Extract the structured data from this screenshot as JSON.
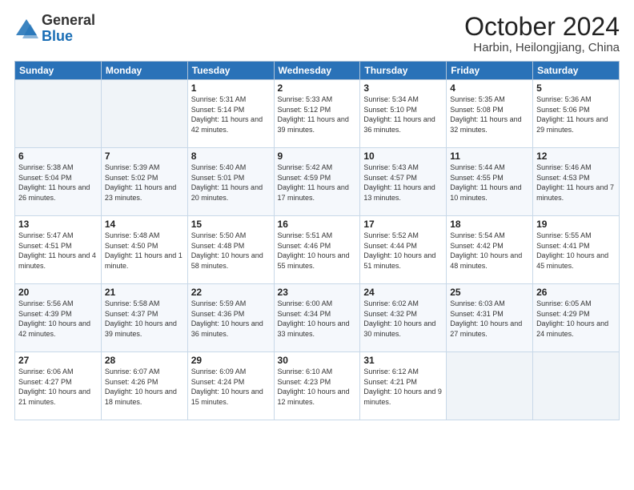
{
  "logo": {
    "general": "General",
    "blue": "Blue"
  },
  "title": "October 2024",
  "location": "Harbin, Heilongjiang, China",
  "days_of_week": [
    "Sunday",
    "Monday",
    "Tuesday",
    "Wednesday",
    "Thursday",
    "Friday",
    "Saturday"
  ],
  "weeks": [
    [
      {
        "day": "",
        "sunrise": "",
        "sunset": "",
        "daylight": ""
      },
      {
        "day": "",
        "sunrise": "",
        "sunset": "",
        "daylight": ""
      },
      {
        "day": "1",
        "sunrise": "Sunrise: 5:31 AM",
        "sunset": "Sunset: 5:14 PM",
        "daylight": "Daylight: 11 hours and 42 minutes."
      },
      {
        "day": "2",
        "sunrise": "Sunrise: 5:33 AM",
        "sunset": "Sunset: 5:12 PM",
        "daylight": "Daylight: 11 hours and 39 minutes."
      },
      {
        "day": "3",
        "sunrise": "Sunrise: 5:34 AM",
        "sunset": "Sunset: 5:10 PM",
        "daylight": "Daylight: 11 hours and 36 minutes."
      },
      {
        "day": "4",
        "sunrise": "Sunrise: 5:35 AM",
        "sunset": "Sunset: 5:08 PM",
        "daylight": "Daylight: 11 hours and 32 minutes."
      },
      {
        "day": "5",
        "sunrise": "Sunrise: 5:36 AM",
        "sunset": "Sunset: 5:06 PM",
        "daylight": "Daylight: 11 hours and 29 minutes."
      }
    ],
    [
      {
        "day": "6",
        "sunrise": "Sunrise: 5:38 AM",
        "sunset": "Sunset: 5:04 PM",
        "daylight": "Daylight: 11 hours and 26 minutes."
      },
      {
        "day": "7",
        "sunrise": "Sunrise: 5:39 AM",
        "sunset": "Sunset: 5:02 PM",
        "daylight": "Daylight: 11 hours and 23 minutes."
      },
      {
        "day": "8",
        "sunrise": "Sunrise: 5:40 AM",
        "sunset": "Sunset: 5:01 PM",
        "daylight": "Daylight: 11 hours and 20 minutes."
      },
      {
        "day": "9",
        "sunrise": "Sunrise: 5:42 AM",
        "sunset": "Sunset: 4:59 PM",
        "daylight": "Daylight: 11 hours and 17 minutes."
      },
      {
        "day": "10",
        "sunrise": "Sunrise: 5:43 AM",
        "sunset": "Sunset: 4:57 PM",
        "daylight": "Daylight: 11 hours and 13 minutes."
      },
      {
        "day": "11",
        "sunrise": "Sunrise: 5:44 AM",
        "sunset": "Sunset: 4:55 PM",
        "daylight": "Daylight: 11 hours and 10 minutes."
      },
      {
        "day": "12",
        "sunrise": "Sunrise: 5:46 AM",
        "sunset": "Sunset: 4:53 PM",
        "daylight": "Daylight: 11 hours and 7 minutes."
      }
    ],
    [
      {
        "day": "13",
        "sunrise": "Sunrise: 5:47 AM",
        "sunset": "Sunset: 4:51 PM",
        "daylight": "Daylight: 11 hours and 4 minutes."
      },
      {
        "day": "14",
        "sunrise": "Sunrise: 5:48 AM",
        "sunset": "Sunset: 4:50 PM",
        "daylight": "Daylight: 11 hours and 1 minute."
      },
      {
        "day": "15",
        "sunrise": "Sunrise: 5:50 AM",
        "sunset": "Sunset: 4:48 PM",
        "daylight": "Daylight: 10 hours and 58 minutes."
      },
      {
        "day": "16",
        "sunrise": "Sunrise: 5:51 AM",
        "sunset": "Sunset: 4:46 PM",
        "daylight": "Daylight: 10 hours and 55 minutes."
      },
      {
        "day": "17",
        "sunrise": "Sunrise: 5:52 AM",
        "sunset": "Sunset: 4:44 PM",
        "daylight": "Daylight: 10 hours and 51 minutes."
      },
      {
        "day": "18",
        "sunrise": "Sunrise: 5:54 AM",
        "sunset": "Sunset: 4:42 PM",
        "daylight": "Daylight: 10 hours and 48 minutes."
      },
      {
        "day": "19",
        "sunrise": "Sunrise: 5:55 AM",
        "sunset": "Sunset: 4:41 PM",
        "daylight": "Daylight: 10 hours and 45 minutes."
      }
    ],
    [
      {
        "day": "20",
        "sunrise": "Sunrise: 5:56 AM",
        "sunset": "Sunset: 4:39 PM",
        "daylight": "Daylight: 10 hours and 42 minutes."
      },
      {
        "day": "21",
        "sunrise": "Sunrise: 5:58 AM",
        "sunset": "Sunset: 4:37 PM",
        "daylight": "Daylight: 10 hours and 39 minutes."
      },
      {
        "day": "22",
        "sunrise": "Sunrise: 5:59 AM",
        "sunset": "Sunset: 4:36 PM",
        "daylight": "Daylight: 10 hours and 36 minutes."
      },
      {
        "day": "23",
        "sunrise": "Sunrise: 6:00 AM",
        "sunset": "Sunset: 4:34 PM",
        "daylight": "Daylight: 10 hours and 33 minutes."
      },
      {
        "day": "24",
        "sunrise": "Sunrise: 6:02 AM",
        "sunset": "Sunset: 4:32 PM",
        "daylight": "Daylight: 10 hours and 30 minutes."
      },
      {
        "day": "25",
        "sunrise": "Sunrise: 6:03 AM",
        "sunset": "Sunset: 4:31 PM",
        "daylight": "Daylight: 10 hours and 27 minutes."
      },
      {
        "day": "26",
        "sunrise": "Sunrise: 6:05 AM",
        "sunset": "Sunset: 4:29 PM",
        "daylight": "Daylight: 10 hours and 24 minutes."
      }
    ],
    [
      {
        "day": "27",
        "sunrise": "Sunrise: 6:06 AM",
        "sunset": "Sunset: 4:27 PM",
        "daylight": "Daylight: 10 hours and 21 minutes."
      },
      {
        "day": "28",
        "sunrise": "Sunrise: 6:07 AM",
        "sunset": "Sunset: 4:26 PM",
        "daylight": "Daylight: 10 hours and 18 minutes."
      },
      {
        "day": "29",
        "sunrise": "Sunrise: 6:09 AM",
        "sunset": "Sunset: 4:24 PM",
        "daylight": "Daylight: 10 hours and 15 minutes."
      },
      {
        "day": "30",
        "sunrise": "Sunrise: 6:10 AM",
        "sunset": "Sunset: 4:23 PM",
        "daylight": "Daylight: 10 hours and 12 minutes."
      },
      {
        "day": "31",
        "sunrise": "Sunrise: 6:12 AM",
        "sunset": "Sunset: 4:21 PM",
        "daylight": "Daylight: 10 hours and 9 minutes."
      },
      {
        "day": "",
        "sunrise": "",
        "sunset": "",
        "daylight": ""
      },
      {
        "day": "",
        "sunrise": "",
        "sunset": "",
        "daylight": ""
      }
    ]
  ]
}
